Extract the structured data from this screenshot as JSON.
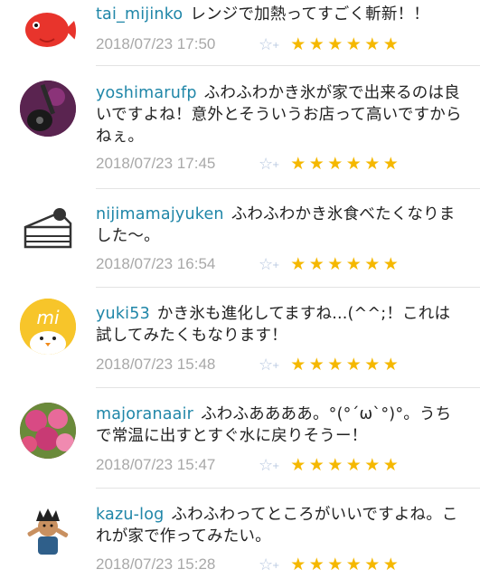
{
  "comments": [
    {
      "user": "tai_mijinko",
      "text": "レンジで加熱ってすごく斬新！！",
      "date": "2018/07/23 17:50",
      "avatar": "red-fish-avatar"
    },
    {
      "user": "yoshimarufp",
      "text": "ふわふわかき氷が家で出来るのは良いですよね！意外とそういうお店って高いですからねぇ。",
      "date": "2018/07/23 17:45",
      "avatar": "guitar-avatar"
    },
    {
      "user": "nijimamajyuken",
      "text": "ふわふわかき氷食べたくなりました〜。",
      "date": "2018/07/23 16:54",
      "avatar": "cake-slice-avatar"
    },
    {
      "user": "yuki53",
      "text": "かき氷も進化してますね...(^^;！これは試してみたくもなります！",
      "date": "2018/07/23 15:48",
      "avatar": "mi-chick-avatar"
    },
    {
      "user": "majoranaair",
      "text": "ふわふああああ。°(°´ω`°)°。うちで常温に出すとすぐ水に戻りそうー！",
      "date": "2018/07/23 15:47",
      "avatar": "roses-avatar"
    },
    {
      "user": "kazu-log",
      "text": "ふわふわってところがいいですよね。これが家で作ってみたい。",
      "date": "2018/07/23 15:28",
      "avatar": "cartoon-man-avatar"
    }
  ],
  "icons": {
    "favorite": "star-outline-plus-icon",
    "rating": "star-icon"
  },
  "rating_stars": 6,
  "colors": {
    "username": "#1f86a8",
    "date": "#a8a8a8",
    "star": "#f5b800"
  }
}
